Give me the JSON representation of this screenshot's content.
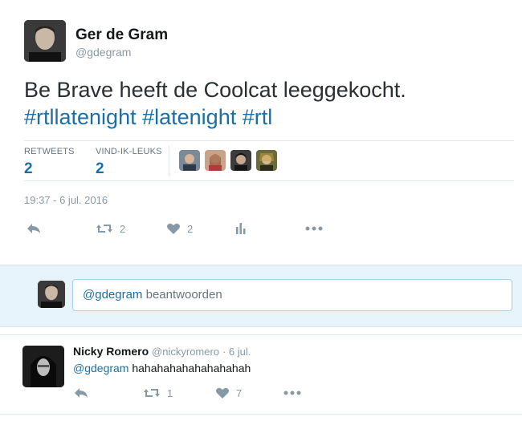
{
  "tweet": {
    "author_name": "Ger de Gram",
    "author_handle": "@gdegram",
    "text": "Be Brave heeft de Coolcat leeggekocht.",
    "hashtags": [
      "#rtllatenight",
      "#latenight",
      "#rtl"
    ],
    "retweets_label": "RETWEETS",
    "retweets_count": "2",
    "likes_label": "VIND-IK-LEUKS",
    "likes_count": "2",
    "timestamp": "19:37 - 6 jul. 2016",
    "actions": {
      "retweet_count": "2",
      "like_count": "2"
    }
  },
  "reply_box": {
    "mention": "@gdegram",
    "text": " beantwoorden"
  },
  "reply": {
    "author_name": "Nicky Romero",
    "author_handle": "@nickyromero",
    "date": "· 6 jul.",
    "mention": "@gdegram",
    "text": " hahahahahahahahahah",
    "actions": {
      "retweet_count": "1",
      "like_count": "7"
    }
  },
  "colors": {
    "link": "#1b6fa8",
    "icon": "#8899a6",
    "reply_bg": "#e8f4fb",
    "divider": "#e1e8ed"
  }
}
